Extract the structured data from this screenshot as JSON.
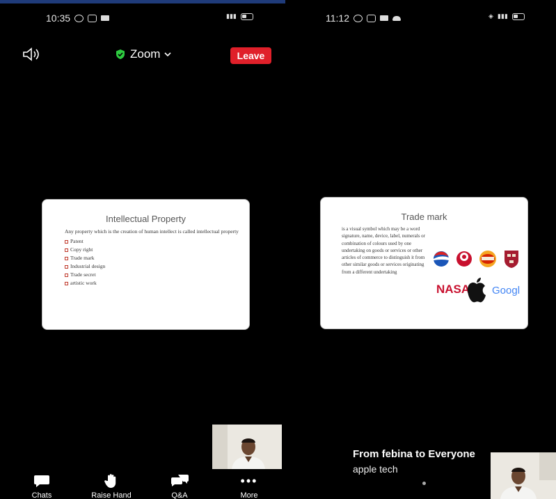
{
  "left_screen": {
    "status_time": "10:35",
    "meeting_name": "Zoom",
    "leave_label": "Leave",
    "slide": {
      "title": "Intellectual Property",
      "intro": "Any property which is the creation of human intellect is called intellectual property",
      "bullets": [
        "Patent",
        "Copy right",
        "Trade mark",
        "Industrial design",
        "Trade secret",
        "artistic work"
      ]
    },
    "toolbar": [
      {
        "label": "Chats",
        "icon": "chat-bubble-icon"
      },
      {
        "label": "Raise Hand",
        "icon": "hand-icon"
      },
      {
        "label": "Q&A",
        "icon": "qa-bubbles-icon"
      },
      {
        "label": "More",
        "icon": "more-dots-icon"
      }
    ]
  },
  "right_screen": {
    "status_time": "11:12",
    "slide": {
      "title": "Trade mark",
      "description": "is a visual symbol which may be a word signature, name, device, label, numerals or combination of colours used by one undertaking on goods or services or other articles of commerce to distinguish it from other similar goods or services originating from a different undertaking",
      "logos": [
        "pepsi-logo",
        "kfc-logo",
        "burger-king-logo",
        "harvard-crest-logo",
        "NASA",
        "apple-logo",
        "Google"
      ]
    },
    "chat": {
      "from": "From febina to Everyone",
      "message": "apple tech"
    }
  },
  "colors": {
    "leave": "#e0202a",
    "shield": "#2ecc40",
    "background": "#000000"
  }
}
